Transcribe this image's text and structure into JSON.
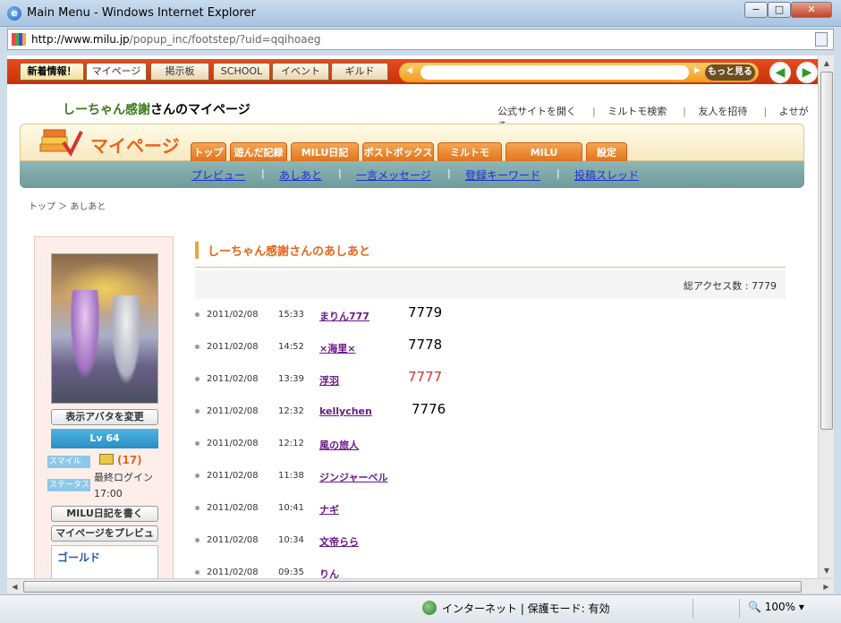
{
  "window": {
    "title": "Main Menu - Windows Internet Explorer",
    "url_host": "http://www.milu.jp",
    "url_path": "/popup_inc/footstep/?uid=qqihoaeg",
    "min": "−",
    "max": "□",
    "close": "✕"
  },
  "topbar": {
    "tabs": [
      "新着情報！",
      "マイページ",
      "掲示板",
      "SCHOOL",
      "イベント",
      "ギルド"
    ],
    "more": "もっと見る",
    "back": "◀",
    "forward": "▶"
  },
  "header": {
    "user_name": "しーちゃん感謝",
    "title_suffix": "さんのマイページ",
    "links": [
      "公式サイトを開く",
      "ミルトモ検索",
      "友人を招待",
      "よせがき"
    ]
  },
  "mypage": {
    "title": "マイページ",
    "tabs": [
      "トップ",
      "遊んだ記録",
      "MILU日記",
      "ポストボックス",
      "ミルトモ",
      "MILU SCHOOL",
      "設定"
    ],
    "subnav": [
      "プレビュー",
      "あしあと",
      "一言メッセージ",
      "登録キーワード",
      "投稿スレッド"
    ]
  },
  "breadcrumb": "トップ ＞ あしあと",
  "profile": {
    "change_avatar": "表示アバタを変更",
    "level": "Lv 64",
    "smile_label": "スマイル",
    "status_label": "ステータス",
    "smile_count": "(17)",
    "last_login_label": "最終ログイン",
    "last_login_time": "17:00",
    "write_diary": "MILU日記を書く",
    "preview_mypage": "マイページをプレビュー",
    "gold_label": "ゴールド"
  },
  "footprints": {
    "title": "しーちゃん感謝さんのあしあと",
    "access_label": "総アクセス数 : 7779",
    "rows": [
      {
        "date": "2011/02/08",
        "time": "15:33",
        "name": "まりん777",
        "note": "7779"
      },
      {
        "date": "2011/02/08",
        "time": "14:52",
        "name": "×海里×",
        "note": "7778"
      },
      {
        "date": "2011/02/08",
        "time": "13:39",
        "name": "浮羽",
        "note": "7777"
      },
      {
        "date": "2011/02/08",
        "time": "12:32",
        "name": "kellychen",
        "note": "7776"
      },
      {
        "date": "2011/02/08",
        "time": "12:12",
        "name": "風の旅人",
        "note": ""
      },
      {
        "date": "2011/02/08",
        "time": "11:38",
        "name": "ジンジャーベル",
        "note": ""
      },
      {
        "date": "2011/02/08",
        "time": "10:41",
        "name": "ナギ",
        "note": ""
      },
      {
        "date": "2011/02/08",
        "time": "10:34",
        "name": "文帝らら",
        "note": ""
      },
      {
        "date": "2011/02/08",
        "time": "09:35",
        "name": "りん",
        "note": ""
      }
    ]
  },
  "statusbar": {
    "zone": "インターネット | 保護モード: 有効",
    "zoom": "100%"
  },
  "colors": {
    "accent_orange": "#e8641a",
    "link_blue": "#1a2dd8",
    "name_purple": "#6a1a8a",
    "highlight_red": "#d83030"
  }
}
